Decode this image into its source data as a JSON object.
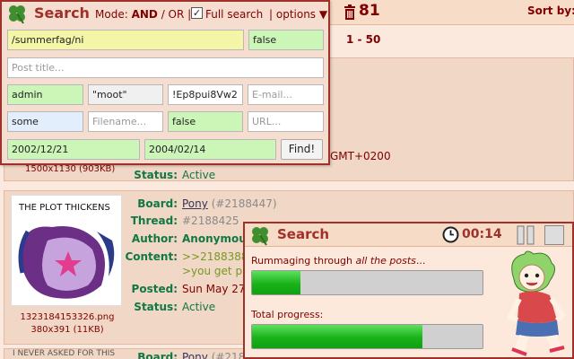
{
  "topbar": {
    "count": "81",
    "sort_label": "Sort by:",
    "range": "1 - 50"
  },
  "search": {
    "title": "Search",
    "mode_label": "Mode:",
    "mode_and": "AND",
    "mode_sep": " / ",
    "mode_or": "OR",
    "full_search_label": "Full search",
    "full_search_checked": "✓",
    "options_label": "| options ▼",
    "fields": {
      "board": "/summerfag/ni",
      "deleted": "false",
      "title_placeholder": "Post title...",
      "name": "admin",
      "trip_name": "\"moot\"",
      "tripcode": "!Ep8pui8Vw2",
      "email_placeholder": "E-mail...",
      "media": "some",
      "filename_placeholder": "Filename...",
      "sticky": "false",
      "url_placeholder": "URL...",
      "date_from": "2002/12/21",
      "date_to": "2004/02/14"
    },
    "find_label": "Find!"
  },
  "post_top": {
    "dims": "1500x1130 (903KB)",
    "status_label": "Status:",
    "status_value": "Active",
    "timezone": "GMT+0200"
  },
  "post_main": {
    "board_label": "Board:",
    "board_value": "Pony",
    "board_num": "(#2188447)",
    "thread_label": "Thread:",
    "thread_value": "#2188425",
    "author_label": "Author:",
    "author_value": "Anonymous",
    "content_label": "Content:",
    "content_line1": ">>2188388",
    "content_line2": ">you get pi",
    "posted_label": "Posted:",
    "posted_value": "Sun May 27",
    "status_label": "Status:",
    "status_value": "Active",
    "thumb_text": "THE PLOT THICKENS",
    "filename": "1323184153326.png",
    "dims": "380x391 (11KB)"
  },
  "post_bottom": {
    "board_label": "Board:",
    "board_value": "Pony",
    "board_num": "(#218",
    "thumb_text": "I NEVER ASKED FOR THIS"
  },
  "dialog": {
    "title": "Search",
    "timer": "00:14",
    "progress1_prefix": "Rummaging through ",
    "progress1_italic": "all the posts",
    "progress1_suffix": "...",
    "progress1_value": 0.21,
    "progress2_label": "Total progress:",
    "progress2_value": 0.74
  },
  "colors": {
    "accent": "#a0302a",
    "label_green": "#117743",
    "valid_field": "#ccf5b8",
    "bar_fill": "#19b219"
  }
}
